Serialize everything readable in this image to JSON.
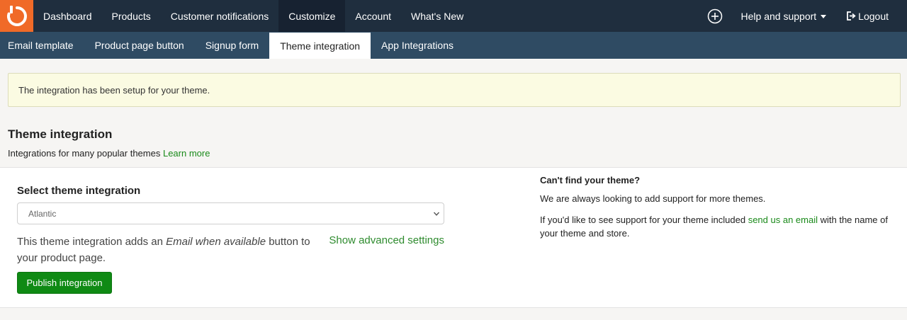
{
  "topnav": {
    "items": [
      {
        "label": "Dashboard"
      },
      {
        "label": "Products"
      },
      {
        "label": "Customer notifications"
      },
      {
        "label": "Customize"
      },
      {
        "label": "Account"
      },
      {
        "label": "What's New"
      }
    ],
    "help_label": "Help and support",
    "logout_label": "Logout"
  },
  "subnav": {
    "items": [
      {
        "label": "Email template"
      },
      {
        "label": "Product page button"
      },
      {
        "label": "Signup form"
      },
      {
        "label": "Theme integration"
      },
      {
        "label": "App Integrations"
      }
    ]
  },
  "alert": {
    "text": "The integration has been setup for your theme."
  },
  "section": {
    "title": "Theme integration",
    "desc": "Integrations for many popular themes",
    "learn_more": "Learn more"
  },
  "card": {
    "select_title": "Select theme integration",
    "select_value": "Atlantic",
    "desc_pre": "This theme integration adds an ",
    "desc_em": "Email when available",
    "desc_post": " button to your product page.",
    "advanced_link": "Show advanced settings",
    "publish_label": "Publish integration"
  },
  "help_panel": {
    "title": "Can't find your theme?",
    "p1": "We are always looking to add support for more themes.",
    "p2_pre": "If you'd like to see support for your theme included ",
    "p2_link": "send us an email",
    "p2_post": " with the name of your theme and store."
  },
  "colors": {
    "topnav_bg": "#1f2e3e",
    "subnav_bg": "#2f4b63",
    "logo_bg": "#f06a28",
    "accent_green": "#0f8a14",
    "alert_bg": "#fbfbe2"
  }
}
